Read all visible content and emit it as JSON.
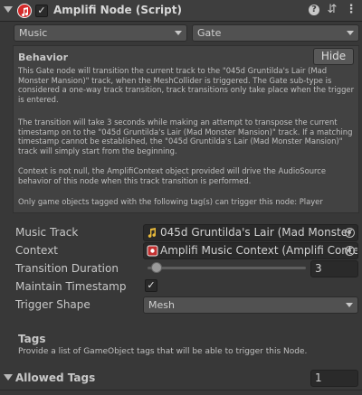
{
  "component": {
    "title": "Amplifi Node (Script)",
    "enabled_glyph": "✓",
    "icons": [
      "foldout-arrow",
      "amplifi-node-icon",
      "help-icon",
      "presets-icon",
      "context-menu-icon"
    ]
  },
  "dropdowns": {
    "category": "Music",
    "node_type": "Gate"
  },
  "behavior": {
    "title": "Behavior",
    "hide_label": "Hide",
    "paragraphs": [
      "This Gate node will transition the current track to the \"045d Gruntilda's Lair (Mad Monster Mansion)\" track, when the MeshCollider is triggered. The Gate sub-type is considered a one-way track transition, track transitions only take place when the trigger is entered.",
      "The transition will take 3 seconds while making an attempt to transpose the current timestamp on to the \"045d Gruntilda's Lair (Mad Monster Mansion)\" track. If a matching timestamp cannot be established, the \"045d Gruntilda's Lair (Mad Monster Mansion)\" track will simply start from the beginning.",
      "Context is not null, the AmplifiContext object provided will drive the AudioSource behavior of this node when this track transition is performed.",
      "Only game objects tagged with the following tag(s) can trigger this node: Player"
    ]
  },
  "fields": {
    "music_track": {
      "label": "Music Track",
      "value": "045d Gruntilda's Lair (Mad Monster",
      "icon": "audio-clip-icon"
    },
    "context": {
      "label": "Context",
      "value": "Amplifi Music Context (Amplifi Conte",
      "icon": "context-object-icon"
    },
    "transition_duration": {
      "label": "Transition Duration",
      "value": "3",
      "slider_fraction": 0.03
    },
    "maintain_timestamp": {
      "label": "Maintain Timestamp",
      "checked_glyph": "✓"
    },
    "trigger_shape": {
      "label": "Trigger Shape",
      "value": "Mesh"
    }
  },
  "tags": {
    "title": "Tags",
    "description": "Provide a list of GameObject tags that will be able to trigger this Node."
  },
  "allowed_tags": {
    "label": "Allowed Tags",
    "count": "1"
  },
  "colors": {
    "background": "#383838",
    "icon_red": "#d52a2a",
    "audio_icon": "#e8b93a"
  }
}
